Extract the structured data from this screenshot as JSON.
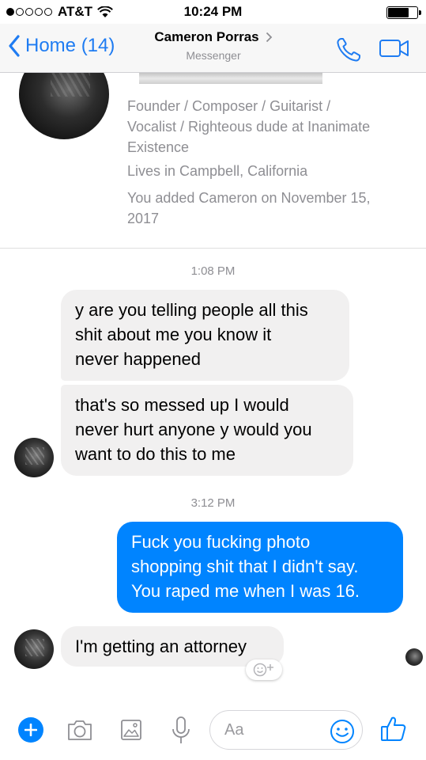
{
  "status_bar": {
    "carrier": "AT&T",
    "time": "10:24 PM",
    "signal_bars_filled": 1,
    "signal_bars_total": 5
  },
  "nav": {
    "back_label": "Home (14)",
    "contact_name": "Cameron Porras",
    "subtitle": "Messenger"
  },
  "profile": {
    "bio_line1": "Founder / Composer / Guitarist /",
    "bio_line2": "Vocalist / Righteous dude at Inanimate",
    "bio_line3": "Existence",
    "location": "Lives in Campbell, California",
    "added_line1": "You added Cameron on November 15,",
    "added_line2": "2017"
  },
  "messages": {
    "time1": "1:08 PM",
    "msg1_line1": "y are you telling people all this",
    "msg1_line2": "shit about me you know it",
    "msg1_line3": "never happened",
    "msg2_line1": "that's so messed up I would",
    "msg2_line2": "never hurt anyone y would you",
    "msg2_line3": "want to do this to me",
    "time2": "3:12 PM",
    "msg3_line1": "Fuck you fucking photo",
    "msg3_line2": "shopping shit that I didn't say.",
    "msg3_line3": "You raped me when I was 16.",
    "msg4": "I'm getting an attorney"
  },
  "composer": {
    "placeholder": "Aa"
  },
  "colors": {
    "accent": "#0084ff",
    "nav_blue": "#1f7cf2",
    "incoming_bubble": "#f1f0f0",
    "muted_text": "#8e8e93"
  },
  "icons": {
    "back": "chevron-left-icon",
    "call": "phone-icon",
    "video": "video-camera-icon",
    "plus": "plus-icon",
    "camera": "camera-icon",
    "gallery": "image-icon",
    "mic": "microphone-icon",
    "emoji": "smiley-icon",
    "like": "thumbs-up-icon",
    "reaction": "add-reaction-icon"
  }
}
